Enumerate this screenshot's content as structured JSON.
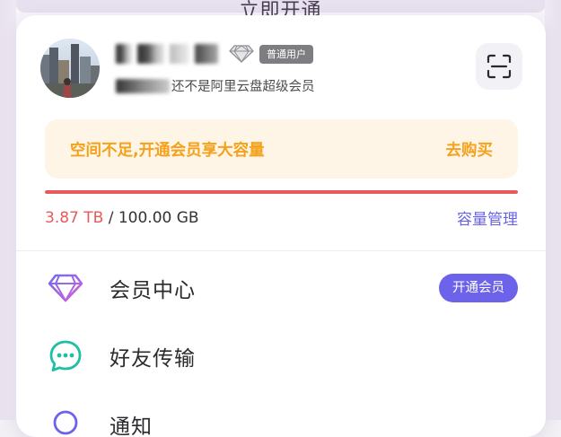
{
  "backdrop": {
    "button_text": "立即开通"
  },
  "profile": {
    "badge": "普通用户",
    "subtitle_suffix": "还不是阿里云盘超级会员"
  },
  "banner": {
    "text": "空间不足,开通会员享大容量",
    "action": "去购买"
  },
  "storage": {
    "used": "3.87 TB",
    "separator": " / ",
    "total": "100.00 GB",
    "manage_label": "容量管理",
    "fill_fraction": 1.0
  },
  "menu": {
    "items": [
      {
        "label": "会员中心",
        "icon": "diamond-icon",
        "action": "开通会员"
      },
      {
        "label": "好友传输",
        "icon": "chat-bubble-icon"
      },
      {
        "label": "通知",
        "icon": "bell-icon"
      }
    ]
  },
  "colors": {
    "accent": "#6c63ea",
    "warning": "#f4a11c",
    "danger": "#e8595a",
    "teal": "#1fbfa3"
  }
}
